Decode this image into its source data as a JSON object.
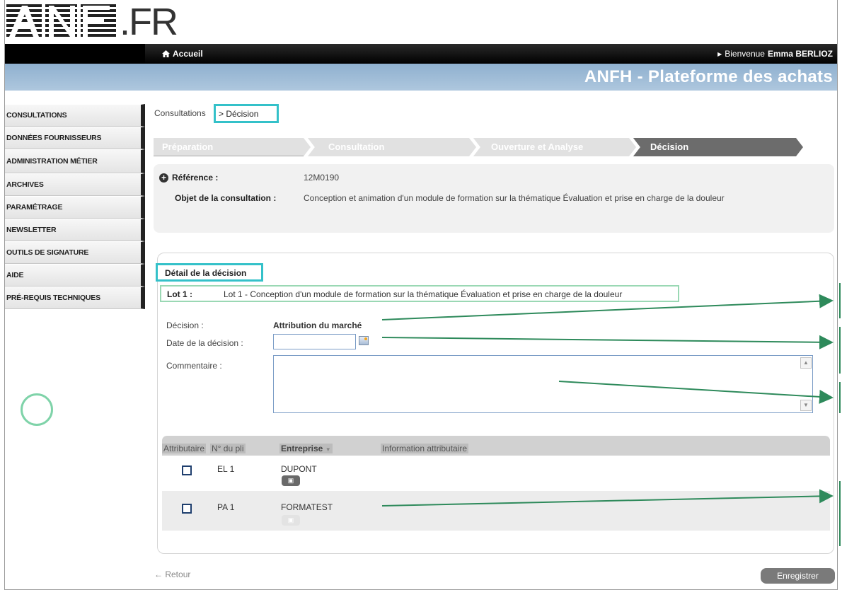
{
  "logo": {
    "suffix": ".FR"
  },
  "topbar": {
    "home_label": "Accueil",
    "welcome_prefix": "Bienvenue",
    "user_name": "Emma BERLIOZ"
  },
  "banner": {
    "title": "ANFH - Plateforme des achats"
  },
  "sidebar": {
    "items": [
      {
        "label": "CONSULTATIONS"
      },
      {
        "label": "DONNÉES FOURNISSEURS"
      },
      {
        "label": "ADMINISTRATION MÉTIER"
      },
      {
        "label": "ARCHIVES"
      },
      {
        "label": "PARAMÉTRAGE"
      },
      {
        "label": "NEWSLETTER"
      },
      {
        "label": "OUTILS DE SIGNATURE"
      },
      {
        "label": "AIDE"
      },
      {
        "label": "PRÉ-REQUIS TECHNIQUES"
      }
    ]
  },
  "breadcrumb": {
    "root": "Consultations",
    "current": "> Décision"
  },
  "steps": [
    {
      "label": "Préparation"
    },
    {
      "label": "Consultation"
    },
    {
      "label": "Ouverture et Analyse"
    },
    {
      "label": "Décision"
    }
  ],
  "reference": {
    "label": "Référence :",
    "value": "12M0190",
    "object_label": "Objet de la consultation :",
    "object_value": "Conception et animation d'un module de formation sur la thématique Évaluation et prise en charge de la douleur"
  },
  "detail": {
    "title": "Détail de la décision",
    "lot_label": "Lot 1 :",
    "lot_value": "Lot 1 - Conception d'un module de formation sur la thématique Évaluation et prise en charge de la douleur",
    "decision_label": "Décision :",
    "decision_value": "Attribution du marché",
    "date_label": "Date de la décision :",
    "date_value": "",
    "comment_label": "Commentaire :",
    "comment_value": ""
  },
  "table": {
    "headers": [
      "Attributaire",
      "N° du pli",
      "Entreprise",
      "Information attributaire"
    ],
    "rows": [
      {
        "pli": "EL 1",
        "entreprise": "DUPONT",
        "checked": false
      },
      {
        "pli": "PA 1",
        "entreprise": "FORMATEST",
        "checked": false
      }
    ]
  },
  "footer": {
    "back_label": "Retour",
    "save_label": "Enregistrer"
  },
  "colors": {
    "highlight": "#34c1c9",
    "annotation": "#2e8a5b",
    "banner": "#9db9d5"
  }
}
